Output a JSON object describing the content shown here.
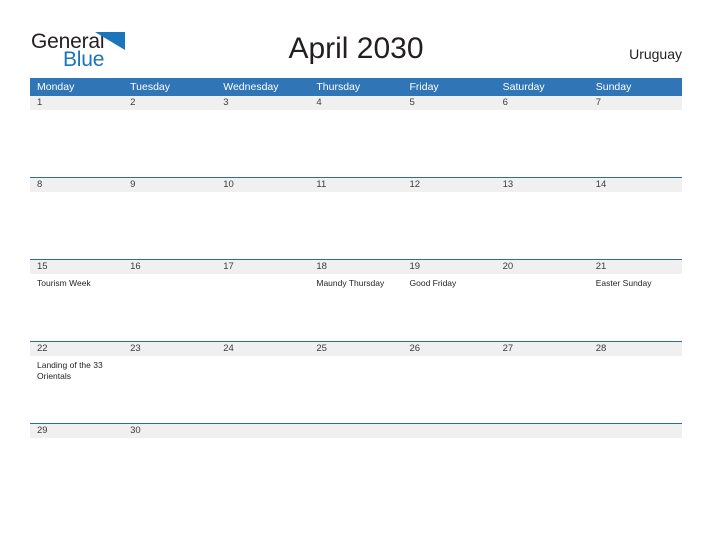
{
  "brand": {
    "name_part1": "General",
    "name_part2": "Blue",
    "flag_icon": "blue-triangle-flag-icon",
    "color_dark": "#231f20",
    "color_blue": "#1b75bb"
  },
  "header": {
    "title": "April 2030",
    "country": "Uruguay"
  },
  "theme": {
    "header_blue": "#3075b5",
    "band_gray": "#f0f0f0",
    "rule_blue": "#2e6da4",
    "text_dark": "#231f20"
  },
  "calendar": {
    "weekdays": [
      "Monday",
      "Tuesday",
      "Wednesday",
      "Thursday",
      "Friday",
      "Saturday",
      "Sunday"
    ],
    "weeks": [
      [
        {
          "day": "1",
          "events": []
        },
        {
          "day": "2",
          "events": []
        },
        {
          "day": "3",
          "events": []
        },
        {
          "day": "4",
          "events": []
        },
        {
          "day": "5",
          "events": []
        },
        {
          "day": "6",
          "events": []
        },
        {
          "day": "7",
          "events": []
        }
      ],
      [
        {
          "day": "8",
          "events": []
        },
        {
          "day": "9",
          "events": []
        },
        {
          "day": "10",
          "events": []
        },
        {
          "day": "11",
          "events": []
        },
        {
          "day": "12",
          "events": []
        },
        {
          "day": "13",
          "events": []
        },
        {
          "day": "14",
          "events": []
        }
      ],
      [
        {
          "day": "15",
          "events": [
            "Tourism Week"
          ]
        },
        {
          "day": "16",
          "events": []
        },
        {
          "day": "17",
          "events": []
        },
        {
          "day": "18",
          "events": [
            "Maundy Thursday"
          ]
        },
        {
          "day": "19",
          "events": [
            "Good Friday"
          ]
        },
        {
          "day": "20",
          "events": []
        },
        {
          "day": "21",
          "events": [
            "Easter Sunday"
          ]
        }
      ],
      [
        {
          "day": "22",
          "events": [
            "Landing of the 33 Orientals"
          ]
        },
        {
          "day": "23",
          "events": []
        },
        {
          "day": "24",
          "events": []
        },
        {
          "day": "25",
          "events": []
        },
        {
          "day": "26",
          "events": []
        },
        {
          "day": "27",
          "events": []
        },
        {
          "day": "28",
          "events": []
        }
      ],
      [
        {
          "day": "29",
          "events": []
        },
        {
          "day": "30",
          "events": []
        },
        {
          "day": "",
          "events": []
        },
        {
          "day": "",
          "events": []
        },
        {
          "day": "",
          "events": []
        },
        {
          "day": "",
          "events": []
        },
        {
          "day": "",
          "events": []
        }
      ]
    ]
  }
}
